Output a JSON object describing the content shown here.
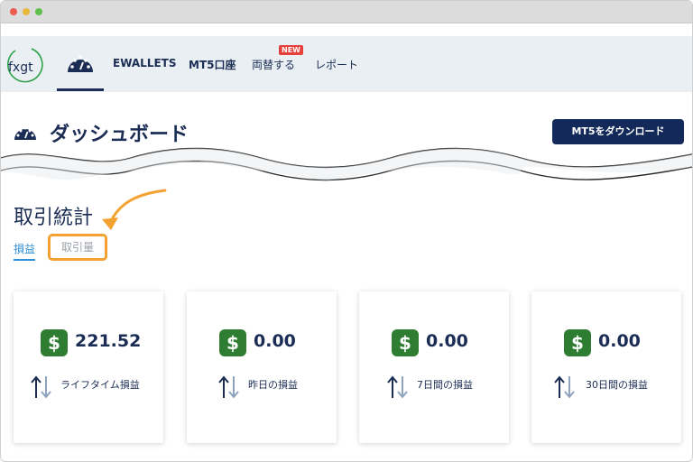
{
  "nav": {
    "logo_text": "fxgt",
    "items": [
      "EWALLETS",
      "MT5口座",
      "両替する",
      "レポート"
    ],
    "new_badge": "NEW"
  },
  "page": {
    "title": "ダッシュボード",
    "download_button": "MT5をダウンロード"
  },
  "stats": {
    "title": "取引統計",
    "tabs": [
      "損益",
      "取引量"
    ],
    "cards": [
      {
        "amount": "221.52",
        "label": "ライフタイム損益"
      },
      {
        "amount": "0.00",
        "label": "昨日の損益"
      },
      {
        "amount": "0.00",
        "label": "7日間の損益"
      },
      {
        "amount": "0.00",
        "label": "30日間の損益"
      }
    ],
    "currency_symbol": "$"
  },
  "colors": {
    "navy": "#1b2d54",
    "button": "#13295a",
    "highlight": "#f3a232",
    "dollar_badge": "#2e7d32",
    "active_tab": "#2f8fd8",
    "new_badge": "#e5403a"
  },
  "icons": [
    "dashboard-gauge-icon",
    "dollar-icon",
    "up-down-arrows-icon",
    "annotation-arrow-icon"
  ]
}
